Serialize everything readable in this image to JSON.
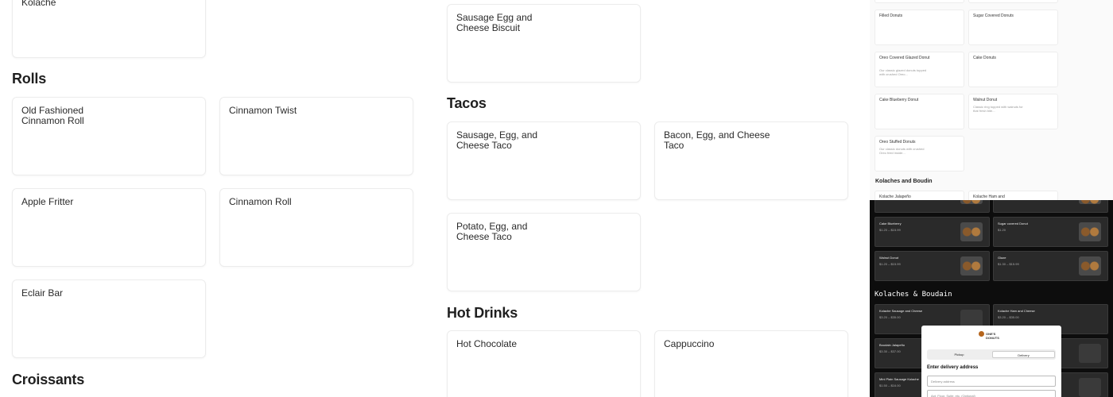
{
  "left_column": {
    "top_card": "Kolache",
    "rolls": {
      "title": "Rolls",
      "items": [
        "Old Fashioned Cinnamon Roll",
        "Cinnamon Twist",
        "Apple Fritter",
        "Cinnamon Roll",
        "Eclair Bar"
      ]
    },
    "croissants_title": "Croissants"
  },
  "middle_column": {
    "top_card": "Sausage Egg and Cheese Biscuit",
    "tacos": {
      "title": "Tacos",
      "items": [
        "Sausage, Egg, and Cheese Taco",
        "Bacon, Egg, and Cheese Taco",
        "Potato, Egg, and Cheese Taco"
      ]
    },
    "hot_drinks": {
      "title": "Hot Drinks",
      "items": [
        "Hot Chocolate",
        "Cappuccino"
      ]
    }
  },
  "light_thumbnail": {
    "items": [
      {
        "title": "Filled Donuts",
        "desc": ""
      },
      {
        "title": "Sugar Covered Donuts",
        "desc": ""
      },
      {
        "title": "Oreo Covered Glazed Donut",
        "desc": "Our classic glazed donuts topped with crushed Oreo..."
      },
      {
        "title": "Cake Donuts",
        "desc": ""
      },
      {
        "title": "Cake Blueberry Donut",
        "desc": ""
      },
      {
        "title": "Walnut Donut",
        "desc": "Classic ring topped with walnuts for that fresh bite..."
      },
      {
        "title": "Oreo Stuffed Donuts",
        "desc": "Our classic donuts with crushed Oreo fried inside..."
      }
    ],
    "section": "Kolaches and Boudin",
    "bottom_items": [
      "Kolache Jalapeño",
      "Kolache Ham and"
    ]
  },
  "dark_thumbnail": {
    "rows": [
      {
        "title": "Cake Blueberry",
        "price": "$1.20 – $15.99"
      },
      {
        "title": "Sugar covered Donut",
        "price": "$1.20"
      },
      {
        "title": "Walnut Donut",
        "price": "$1.20 – $15.99"
      },
      {
        "title": "Glaze",
        "price": "$1.30 – $15.99"
      }
    ],
    "section": "Kolaches & Boudain",
    "kolache_rows": [
      {
        "title": "Kolache Sausage and Cheese",
        "price": "$3.20 – $35.00"
      },
      {
        "title": "Kolache Ham and Cheese",
        "price": "$3.20 – $35.00"
      },
      {
        "title": "Boudain Jalapeño",
        "price": "$3.30 – $37.00"
      },
      {
        "title": "Mini Plain Sausage Kolache",
        "price": "$1.50 – $16.00"
      }
    ],
    "modal": {
      "logo_text": "ONE'S DONUTS",
      "pickup": "Pickup",
      "delivery": "Delivery",
      "heading": "Enter delivery address",
      "address_placeholder": "Delivery address",
      "apt_placeholder": "Apt, Floor, Suite, etc. (Optional)"
    }
  }
}
